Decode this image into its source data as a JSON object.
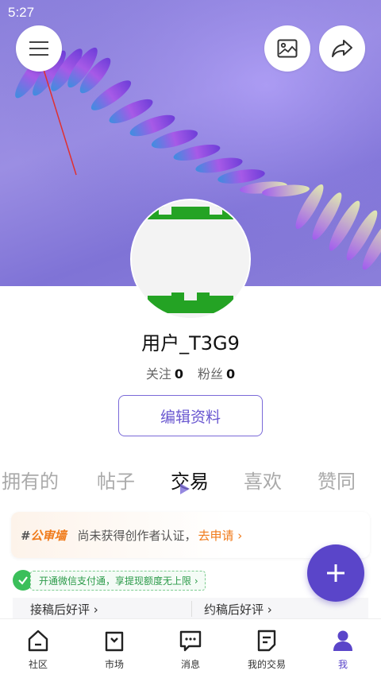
{
  "status_bar": {
    "time": "5:27"
  },
  "header": {
    "menu_icon": "hamburger-menu-icon",
    "gallery_icon": "image-icon",
    "share_icon": "share-arrow-icon"
  },
  "profile": {
    "username": "用户_T3G9",
    "following_label": "关注",
    "following_count": "0",
    "followers_label": "粉丝",
    "followers_count": "0",
    "edit_button": "编辑资料"
  },
  "tabs": [
    {
      "label": "拥有的"
    },
    {
      "label": "帖子"
    },
    {
      "label": "交易"
    },
    {
      "label": "喜欢"
    },
    {
      "label": "赞同"
    }
  ],
  "creator": {
    "hash": "#",
    "logo_text": "公审墙",
    "text": "尚未获得创作者认证，",
    "link": "去申请 ›"
  },
  "wechat": {
    "text": "开通微信支付通，享提现额度无上限 ›"
  },
  "reviews": {
    "left": "接稿后好评 ›",
    "right": "约稿后好评 ›"
  },
  "bottom_nav": [
    {
      "label": "社区",
      "icon": "home-icon"
    },
    {
      "label": "市场",
      "icon": "shop-bag-icon"
    },
    {
      "label": "消息",
      "icon": "message-icon"
    },
    {
      "label": "我的交易",
      "icon": "order-icon"
    },
    {
      "label": "我",
      "icon": "profile-icon"
    }
  ],
  "colors": {
    "accent": "#5a45c9",
    "orange": "#f07a1a",
    "green": "#3bbf5a",
    "banner": "#8a7fdb"
  }
}
